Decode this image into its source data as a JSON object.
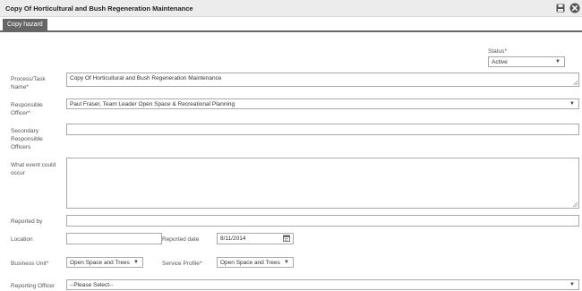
{
  "window": {
    "title": "Copy Of Horticultural and Bush Regeneration Maintenance",
    "save_icon": "save-icon",
    "close_icon": "close-icon"
  },
  "toolbar": {
    "copy_label": "Copy hazard"
  },
  "form": {
    "status": {
      "label": "Status",
      "required_mark": "*",
      "value": "Active"
    },
    "process_name": {
      "label": "Process/Task Name",
      "required_mark": "*",
      "value": "Copy Of Horticultural and Bush Regeneration Maintenance"
    },
    "responsible_officer": {
      "label": "Responsible Officer",
      "required_mark": "*",
      "value": "Paul Fraser, Team Leader Open Space & Recreational Planning"
    },
    "secondary_officers": {
      "label": "Secondary Responsible Officers",
      "value": ""
    },
    "event": {
      "label": "What event could occur",
      "value": ""
    },
    "reported_by": {
      "label": "Reported by",
      "value": ""
    },
    "location": {
      "label": "Location",
      "value": ""
    },
    "reported_date": {
      "label": "Reported date",
      "value": "8/11/2014"
    },
    "business_unit": {
      "label": "Business Unit",
      "required_mark": "*",
      "value": "Open Space and Trees"
    },
    "service_profile": {
      "label": "Service Profile",
      "required_mark": "*",
      "value": "Open Space and Trees"
    },
    "reporting_officer": {
      "label": "Reporting Officer",
      "value": "--Please Select--"
    }
  },
  "caret_glyph": "▼"
}
